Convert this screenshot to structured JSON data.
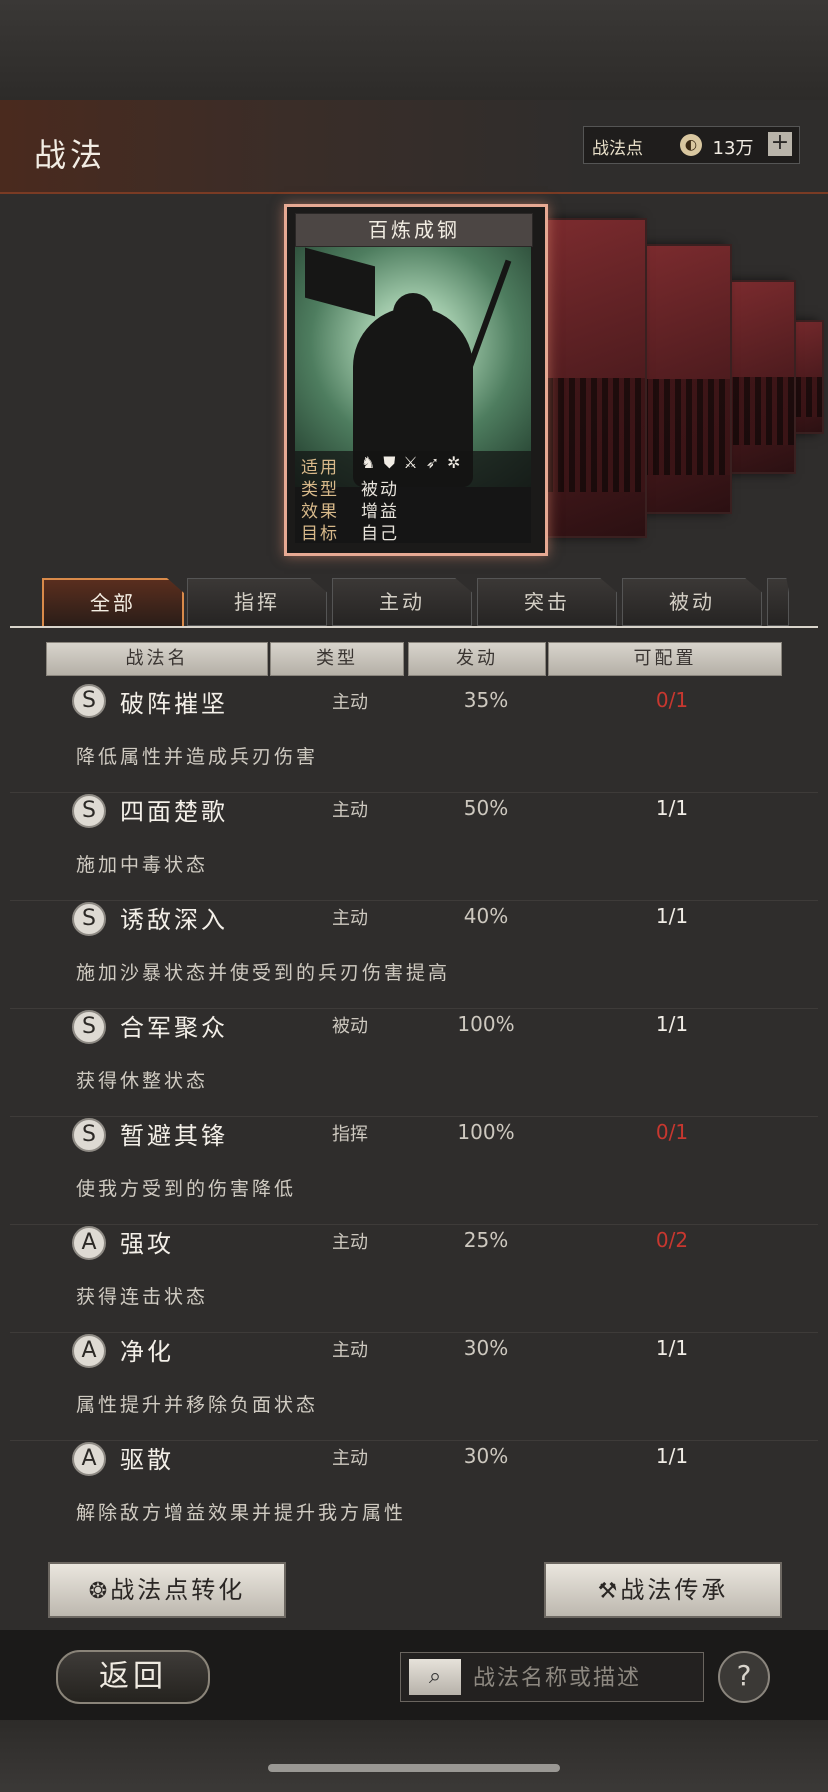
{
  "header": {
    "title": "战法",
    "points_label": "战法点",
    "points_value": "13万",
    "plus_label": "+"
  },
  "card": {
    "title": "百炼成钢",
    "stats": [
      {
        "key": "适用",
        "value": ""
      },
      {
        "key": "类型",
        "value": "被动"
      },
      {
        "key": "效果",
        "value": "增益"
      },
      {
        "key": "目标",
        "value": "自己"
      }
    ],
    "unit_icons": [
      "cavalry-icon",
      "shield-icon",
      "bow-icon",
      "spear-icon",
      "wheel-icon"
    ]
  },
  "tabs": [
    "全部",
    "指挥",
    "主动",
    "突击",
    "被动"
  ],
  "active_tab": 0,
  "table_headers": [
    "战法名",
    "类型",
    "发动",
    "可配置"
  ],
  "skills": [
    {
      "grade": "S",
      "name": "破阵摧坚",
      "type": "主动",
      "rate": "35%",
      "config": "0/1",
      "config_red": true,
      "desc": "降低属性并造成兵刃伤害"
    },
    {
      "grade": "S",
      "name": "四面楚歌",
      "type": "主动",
      "rate": "50%",
      "config": "1/1",
      "config_red": false,
      "desc": "施加中毒状态"
    },
    {
      "grade": "S",
      "name": "诱敌深入",
      "type": "主动",
      "rate": "40%",
      "config": "1/1",
      "config_red": false,
      "desc": "施加沙暴状态并使受到的兵刃伤害提高"
    },
    {
      "grade": "S",
      "name": "合军聚众",
      "type": "被动",
      "rate": "100%",
      "config": "1/1",
      "config_red": false,
      "desc": "获得休整状态"
    },
    {
      "grade": "S",
      "name": "暂避其锋",
      "type": "指挥",
      "rate": "100%",
      "config": "0/1",
      "config_red": true,
      "desc": "使我方受到的伤害降低"
    },
    {
      "grade": "A",
      "name": "强攻",
      "type": "主动",
      "rate": "25%",
      "config": "0/2",
      "config_red": true,
      "desc": "获得连击状态"
    },
    {
      "grade": "A",
      "name": "净化",
      "type": "主动",
      "rate": "30%",
      "config": "1/1",
      "config_red": false,
      "desc": "属性提升并移除负面状态"
    },
    {
      "grade": "A",
      "name": "驱散",
      "type": "主动",
      "rate": "30%",
      "config": "1/1",
      "config_red": false,
      "desc": "解除敌方增益效果并提升我方属性"
    }
  ],
  "buttons": {
    "convert": "战法点转化",
    "inherit": "战法传承",
    "back": "返回",
    "help": "?"
  },
  "search": {
    "placeholder": "战法名称或描述"
  },
  "colors": {
    "accent": "#d98a4a",
    "warn": "#c8372f"
  }
}
